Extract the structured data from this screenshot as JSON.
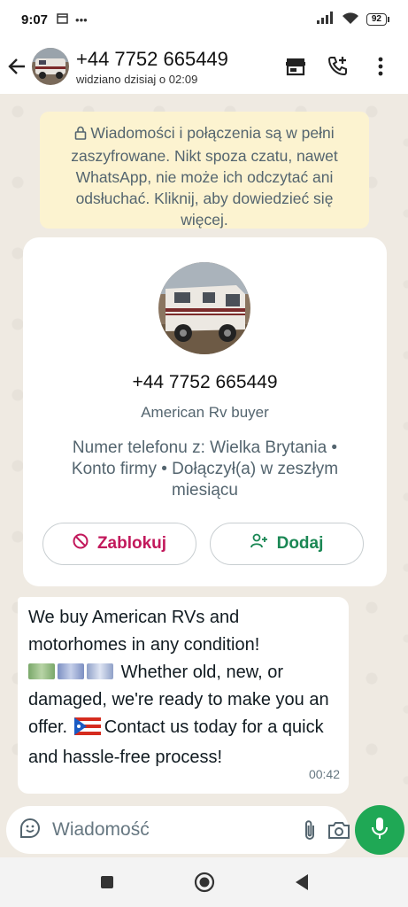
{
  "status_bar": {
    "time": "9:07",
    "battery": "92",
    "icons": [
      "calendar-icon",
      "more-dots-icon",
      "signal-icon",
      "wifi-icon",
      "battery-icon"
    ]
  },
  "header": {
    "contact_name": "+44 7752 665449",
    "last_seen": "widziano dzisiaj o 02:09",
    "actions": [
      "store-icon",
      "add-call-icon",
      "more-vert-icon"
    ]
  },
  "encryption_notice": {
    "text": "Wiadomości i połączenia są w pełni zaszyfrowane. Nikt spoza czatu, nawet WhatsApp, nie może ich odczytać ani odsłuchać. Kliknij, aby dowiedzieć się więcej."
  },
  "profile_card": {
    "phone": "+44 7752 665449",
    "description": "American Rv buyer",
    "meta": "Numer telefonu z: Wielka Brytania • Konto firmy • Dołączył(a) w zeszłym miesiącu",
    "block_label": "Zablokuj",
    "add_label": "Dodaj"
  },
  "message": {
    "line1": "We buy American RVs and motorhomes in any condition!",
    "line2": "Whether old, new, or damaged, we're ready to make you an offer.",
    "line3": "Contact us today for a quick and hassle-free process!",
    "time": "00:42",
    "emojis": [
      "banknote-dollar",
      "banknote-euro",
      "banknote-pound",
      "flag-puerto-rico"
    ]
  },
  "input": {
    "placeholder": "Wiadomość"
  },
  "colors": {
    "header_bg": "#ffffff",
    "chat_bg": "#efeae2",
    "notice_bg": "#fcf3d0",
    "accent_green": "#1fa855",
    "block_red": "#c2185b",
    "add_green": "#1a8754"
  }
}
